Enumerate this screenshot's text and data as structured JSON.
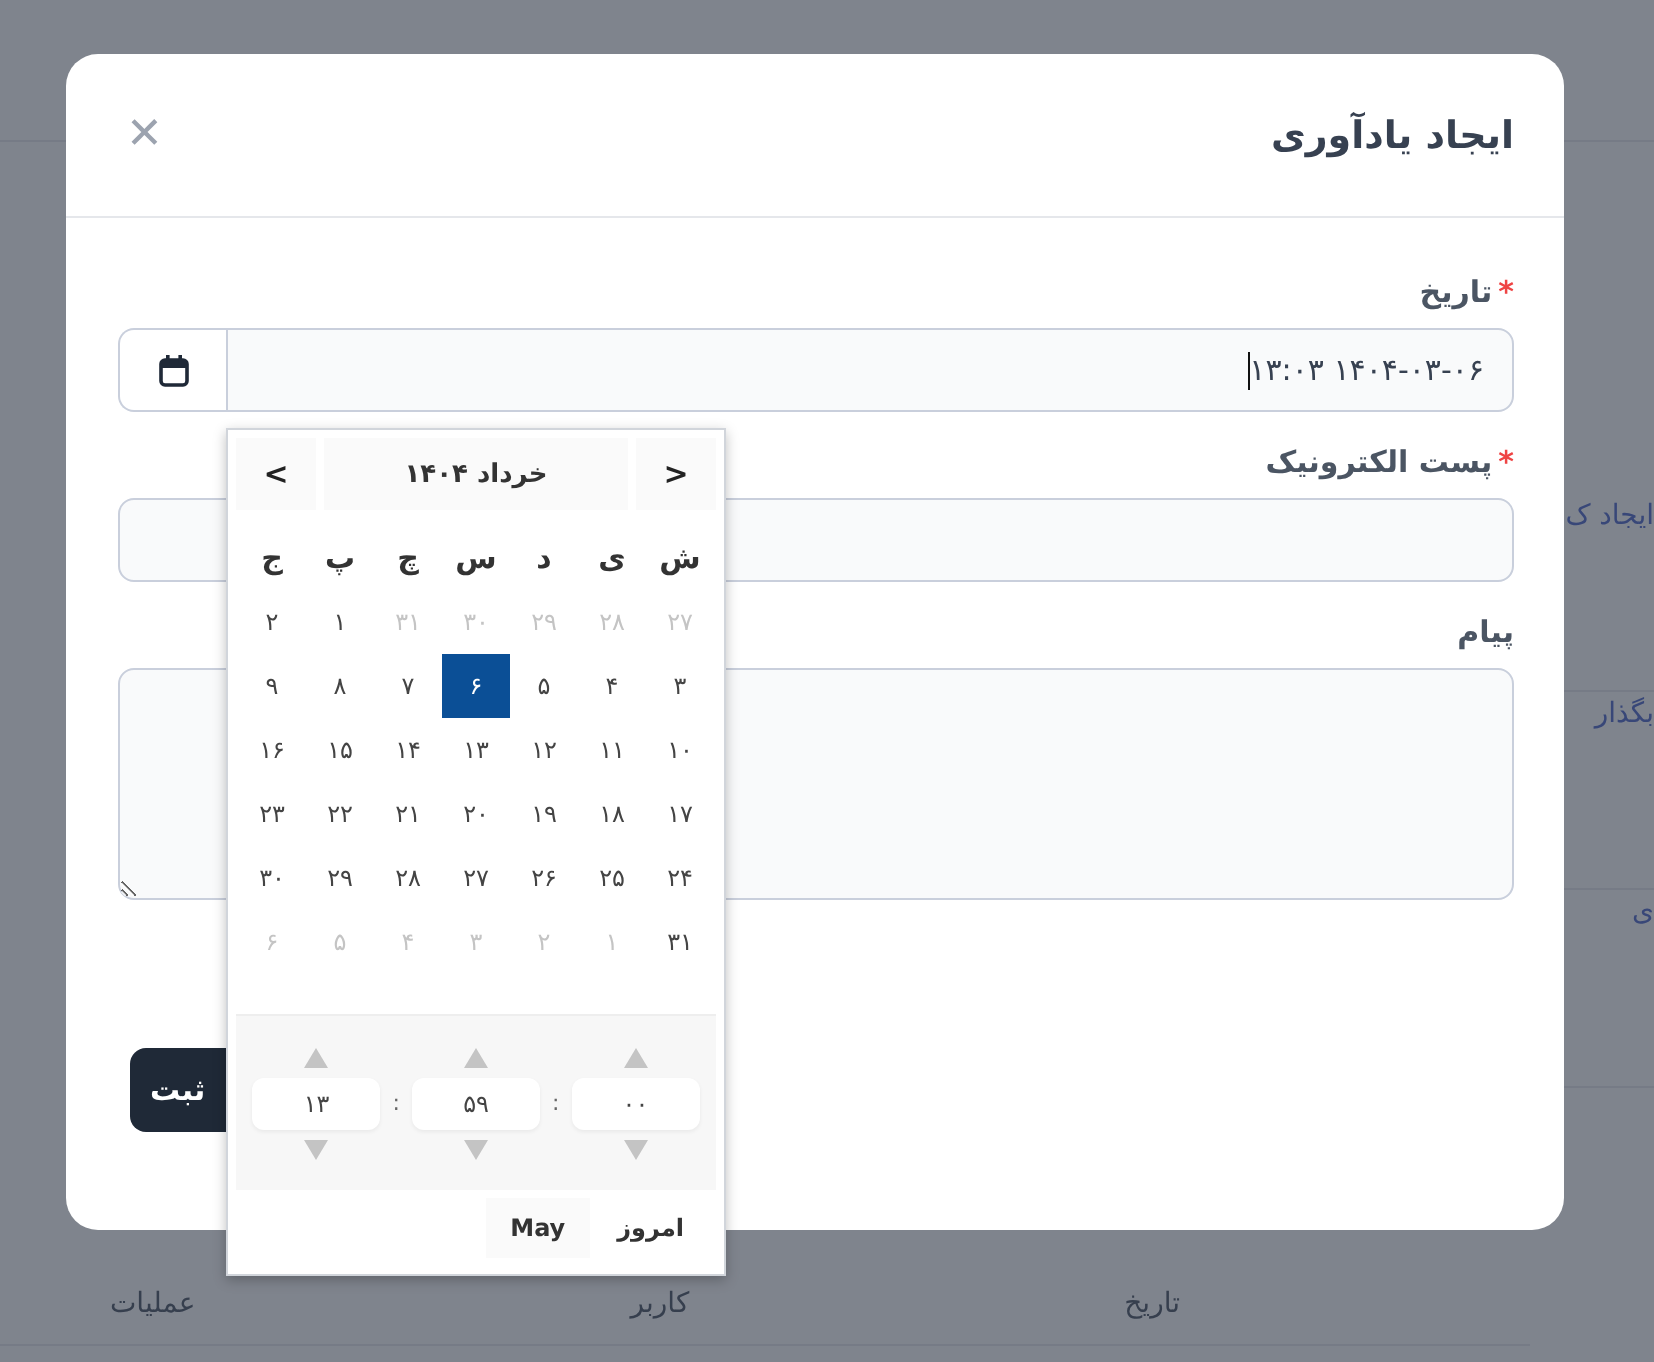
{
  "background": {
    "side_links": [
      "ایجاد ک",
      "بگذار",
      "ی"
    ],
    "table_headers": [
      "تاریخ",
      "کاربر",
      "عملیات"
    ]
  },
  "dialog": {
    "title": "ایجاد یادآوری",
    "close": "✕",
    "fields": [
      {
        "kind": "date",
        "label": "تاریخ",
        "required": true,
        "value": "۱۴۰۴-۰۳-۰۶ ۱۳:۰۳"
      },
      {
        "kind": "text",
        "label": "پست الکترونیک",
        "required": true
      },
      {
        "kind": "textarea",
        "label": "پیام",
        "required": false
      }
    ],
    "submit": "ثبت",
    "required_mark": "*"
  },
  "datepicker": {
    "prev": "<",
    "next": ">",
    "month": "خرداد ۱۴۰۴",
    "weekdays": [
      "ش",
      "ی",
      "د",
      "س",
      "چ",
      "پ",
      "ج"
    ],
    "weeks": [
      [
        {
          "day": "۲۷",
          "muted": true,
          "selected": false
        },
        {
          "day": "۲۸",
          "muted": true,
          "selected": false
        },
        {
          "day": "۲۹",
          "muted": true,
          "selected": false
        },
        {
          "day": "۳۰",
          "muted": true,
          "selected": false
        },
        {
          "day": "۳۱",
          "muted": true,
          "selected": false
        },
        {
          "day": "۱",
          "muted": false,
          "selected": false
        },
        {
          "day": "۲",
          "muted": false,
          "selected": false
        }
      ],
      [
        {
          "day": "۳",
          "muted": false,
          "selected": false
        },
        {
          "day": "۴",
          "muted": false,
          "selected": false
        },
        {
          "day": "۵",
          "muted": false,
          "selected": false
        },
        {
          "day": "۶",
          "muted": false,
          "selected": true
        },
        {
          "day": "۷",
          "muted": false,
          "selected": false
        },
        {
          "day": "۸",
          "muted": false,
          "selected": false
        },
        {
          "day": "۹",
          "muted": false,
          "selected": false
        }
      ],
      [
        {
          "day": "۱۰",
          "muted": false,
          "selected": false
        },
        {
          "day": "۱۱",
          "muted": false,
          "selected": false
        },
        {
          "day": "۱۲",
          "muted": false,
          "selected": false
        },
        {
          "day": "۱۳",
          "muted": false,
          "selected": false
        },
        {
          "day": "۱۴",
          "muted": false,
          "selected": false
        },
        {
          "day": "۱۵",
          "muted": false,
          "selected": false
        },
        {
          "day": "۱۶",
          "muted": false,
          "selected": false
        }
      ],
      [
        {
          "day": "۱۷",
          "muted": false,
          "selected": false
        },
        {
          "day": "۱۸",
          "muted": false,
          "selected": false
        },
        {
          "day": "۱۹",
          "muted": false,
          "selected": false
        },
        {
          "day": "۲۰",
          "muted": false,
          "selected": false
        },
        {
          "day": "۲۱",
          "muted": false,
          "selected": false
        },
        {
          "day": "۲۲",
          "muted": false,
          "selected": false
        },
        {
          "day": "۲۳",
          "muted": false,
          "selected": false
        }
      ],
      [
        {
          "day": "۲۴",
          "muted": false,
          "selected": false
        },
        {
          "day": "۲۵",
          "muted": false,
          "selected": false
        },
        {
          "day": "۲۶",
          "muted": false,
          "selected": false
        },
        {
          "day": "۲۷",
          "muted": false,
          "selected": false
        },
        {
          "day": "۲۸",
          "muted": false,
          "selected": false
        },
        {
          "day": "۲۹",
          "muted": false,
          "selected": false
        },
        {
          "day": "۳۰",
          "muted": false,
          "selected": false
        }
      ],
      [
        {
          "day": "۳۱",
          "muted": false,
          "selected": false
        },
        {
          "day": "۱",
          "muted": true,
          "selected": false
        },
        {
          "day": "۲",
          "muted": true,
          "selected": false
        },
        {
          "day": "۳",
          "muted": true,
          "selected": false
        },
        {
          "day": "۴",
          "muted": true,
          "selected": false
        },
        {
          "day": "۵",
          "muted": true,
          "selected": false
        },
        {
          "day": "۶",
          "muted": true,
          "selected": false
        }
      ]
    ],
    "time": [
      "۰۰",
      "۵۹",
      "۱۳"
    ],
    "separator": ":",
    "today": "امروز",
    "month_button": "May"
  }
}
